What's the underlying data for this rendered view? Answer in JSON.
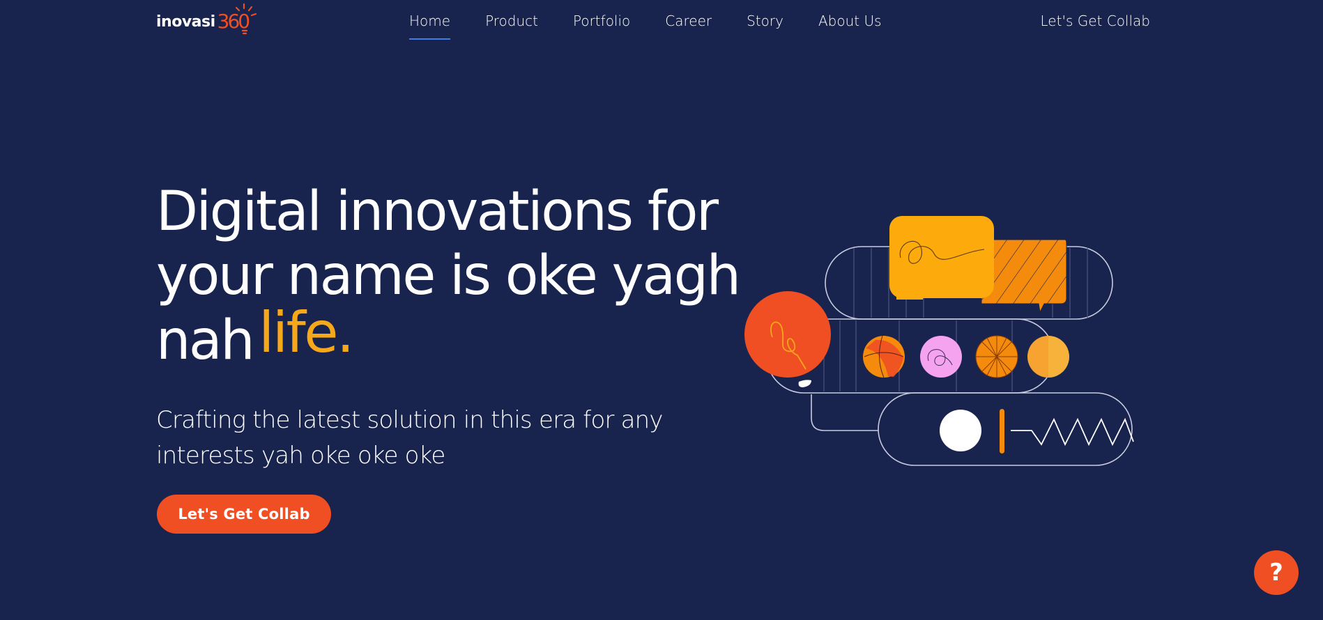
{
  "brand": {
    "name": "inovasi",
    "number": "360",
    "accent_color": "#f04e23",
    "background_color": "#19244e"
  },
  "nav": {
    "items": [
      {
        "label": "Home",
        "active": true
      },
      {
        "label": "Product",
        "active": false
      },
      {
        "label": "Portfolio",
        "active": false
      },
      {
        "label": "Career",
        "active": false
      },
      {
        "label": "Story",
        "active": false
      },
      {
        "label": "About Us",
        "active": false
      }
    ],
    "collab_label": "Let's Get Collab"
  },
  "hero": {
    "headline_line1": "Digital innovations for",
    "headline_line2": "your name is oke yagh",
    "headline_line3": "nah",
    "headline_accent": "life.",
    "headline_accent_color": "#f6a81a",
    "subhead": "Crafting the latest solution in this era for any interests yah oke oke oke",
    "cta_label": "Let's Get Collab"
  },
  "help": {
    "label": "?",
    "icon": "help-icon"
  }
}
